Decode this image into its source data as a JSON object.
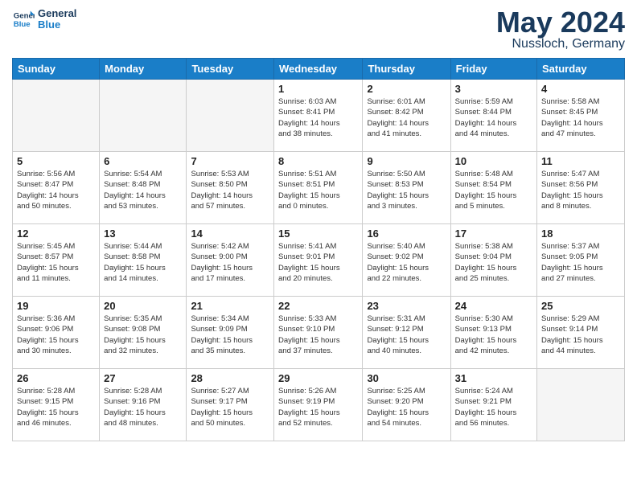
{
  "logo": {
    "line1": "General",
    "line2": "Blue"
  },
  "header": {
    "month": "May 2024",
    "location": "Nussloch, Germany"
  },
  "weekdays": [
    "Sunday",
    "Monday",
    "Tuesday",
    "Wednesday",
    "Thursday",
    "Friday",
    "Saturday"
  ],
  "weeks": [
    [
      {
        "day": "",
        "info": ""
      },
      {
        "day": "",
        "info": ""
      },
      {
        "day": "",
        "info": ""
      },
      {
        "day": "1",
        "info": "Sunrise: 6:03 AM\nSunset: 8:41 PM\nDaylight: 14 hours\nand 38 minutes."
      },
      {
        "day": "2",
        "info": "Sunrise: 6:01 AM\nSunset: 8:42 PM\nDaylight: 14 hours\nand 41 minutes."
      },
      {
        "day": "3",
        "info": "Sunrise: 5:59 AM\nSunset: 8:44 PM\nDaylight: 14 hours\nand 44 minutes."
      },
      {
        "day": "4",
        "info": "Sunrise: 5:58 AM\nSunset: 8:45 PM\nDaylight: 14 hours\nand 47 minutes."
      }
    ],
    [
      {
        "day": "5",
        "info": "Sunrise: 5:56 AM\nSunset: 8:47 PM\nDaylight: 14 hours\nand 50 minutes."
      },
      {
        "day": "6",
        "info": "Sunrise: 5:54 AM\nSunset: 8:48 PM\nDaylight: 14 hours\nand 53 minutes."
      },
      {
        "day": "7",
        "info": "Sunrise: 5:53 AM\nSunset: 8:50 PM\nDaylight: 14 hours\nand 57 minutes."
      },
      {
        "day": "8",
        "info": "Sunrise: 5:51 AM\nSunset: 8:51 PM\nDaylight: 15 hours\nand 0 minutes."
      },
      {
        "day": "9",
        "info": "Sunrise: 5:50 AM\nSunset: 8:53 PM\nDaylight: 15 hours\nand 3 minutes."
      },
      {
        "day": "10",
        "info": "Sunrise: 5:48 AM\nSunset: 8:54 PM\nDaylight: 15 hours\nand 5 minutes."
      },
      {
        "day": "11",
        "info": "Sunrise: 5:47 AM\nSunset: 8:56 PM\nDaylight: 15 hours\nand 8 minutes."
      }
    ],
    [
      {
        "day": "12",
        "info": "Sunrise: 5:45 AM\nSunset: 8:57 PM\nDaylight: 15 hours\nand 11 minutes."
      },
      {
        "day": "13",
        "info": "Sunrise: 5:44 AM\nSunset: 8:58 PM\nDaylight: 15 hours\nand 14 minutes."
      },
      {
        "day": "14",
        "info": "Sunrise: 5:42 AM\nSunset: 9:00 PM\nDaylight: 15 hours\nand 17 minutes."
      },
      {
        "day": "15",
        "info": "Sunrise: 5:41 AM\nSunset: 9:01 PM\nDaylight: 15 hours\nand 20 minutes."
      },
      {
        "day": "16",
        "info": "Sunrise: 5:40 AM\nSunset: 9:02 PM\nDaylight: 15 hours\nand 22 minutes."
      },
      {
        "day": "17",
        "info": "Sunrise: 5:38 AM\nSunset: 9:04 PM\nDaylight: 15 hours\nand 25 minutes."
      },
      {
        "day": "18",
        "info": "Sunrise: 5:37 AM\nSunset: 9:05 PM\nDaylight: 15 hours\nand 27 minutes."
      }
    ],
    [
      {
        "day": "19",
        "info": "Sunrise: 5:36 AM\nSunset: 9:06 PM\nDaylight: 15 hours\nand 30 minutes."
      },
      {
        "day": "20",
        "info": "Sunrise: 5:35 AM\nSunset: 9:08 PM\nDaylight: 15 hours\nand 32 minutes."
      },
      {
        "day": "21",
        "info": "Sunrise: 5:34 AM\nSunset: 9:09 PM\nDaylight: 15 hours\nand 35 minutes."
      },
      {
        "day": "22",
        "info": "Sunrise: 5:33 AM\nSunset: 9:10 PM\nDaylight: 15 hours\nand 37 minutes."
      },
      {
        "day": "23",
        "info": "Sunrise: 5:31 AM\nSunset: 9:12 PM\nDaylight: 15 hours\nand 40 minutes."
      },
      {
        "day": "24",
        "info": "Sunrise: 5:30 AM\nSunset: 9:13 PM\nDaylight: 15 hours\nand 42 minutes."
      },
      {
        "day": "25",
        "info": "Sunrise: 5:29 AM\nSunset: 9:14 PM\nDaylight: 15 hours\nand 44 minutes."
      }
    ],
    [
      {
        "day": "26",
        "info": "Sunrise: 5:28 AM\nSunset: 9:15 PM\nDaylight: 15 hours\nand 46 minutes."
      },
      {
        "day": "27",
        "info": "Sunrise: 5:28 AM\nSunset: 9:16 PM\nDaylight: 15 hours\nand 48 minutes."
      },
      {
        "day": "28",
        "info": "Sunrise: 5:27 AM\nSunset: 9:17 PM\nDaylight: 15 hours\nand 50 minutes."
      },
      {
        "day": "29",
        "info": "Sunrise: 5:26 AM\nSunset: 9:19 PM\nDaylight: 15 hours\nand 52 minutes."
      },
      {
        "day": "30",
        "info": "Sunrise: 5:25 AM\nSunset: 9:20 PM\nDaylight: 15 hours\nand 54 minutes."
      },
      {
        "day": "31",
        "info": "Sunrise: 5:24 AM\nSunset: 9:21 PM\nDaylight: 15 hours\nand 56 minutes."
      },
      {
        "day": "",
        "info": ""
      }
    ]
  ]
}
